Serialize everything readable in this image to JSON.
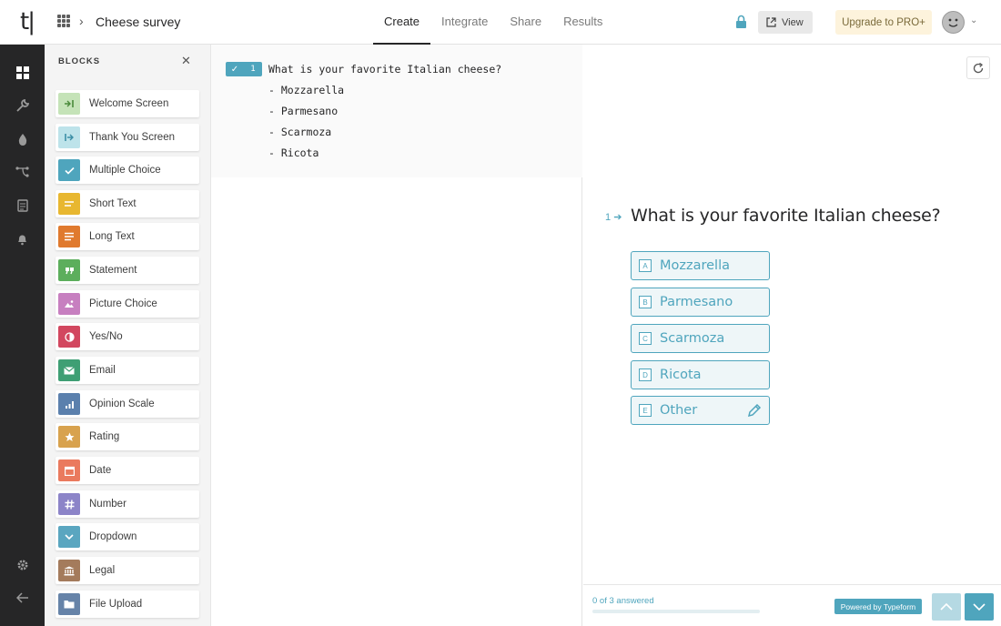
{
  "header": {
    "logo": "t|",
    "form_title": "Cheese survey",
    "tabs": [
      {
        "label": "Create",
        "active": true
      },
      {
        "label": "Integrate",
        "active": false
      },
      {
        "label": "Share",
        "active": false
      },
      {
        "label": "Results",
        "active": false
      }
    ],
    "view_label": "View",
    "upgrade_label": "Upgrade to PRO+"
  },
  "rail": {
    "icons": [
      "blocks-icon",
      "wrench-icon",
      "drop-icon",
      "logic-icon",
      "clipboard-icon",
      "bell-icon",
      "settings-icon",
      "back-arrow-icon"
    ]
  },
  "blocks_panel": {
    "title": "BLOCKS",
    "items": [
      {
        "label": "Welcome Screen",
        "color": "#c5e3b8",
        "icon": "welcome-icon"
      },
      {
        "label": "Thank You Screen",
        "color": "#bde3ea",
        "icon": "thank-you-icon"
      },
      {
        "label": "Multiple Choice",
        "color": "#4fa5bd",
        "icon": "check-icon"
      },
      {
        "label": "Short Text",
        "color": "#e8b730",
        "icon": "short-text-icon"
      },
      {
        "label": "Long Text",
        "color": "#e07a2e",
        "icon": "long-text-icon"
      },
      {
        "label": "Statement",
        "color": "#5cae5c",
        "icon": "quote-icon"
      },
      {
        "label": "Picture Choice",
        "color": "#c77fc0",
        "icon": "picture-icon"
      },
      {
        "label": "Yes/No",
        "color": "#d2475f",
        "icon": "yes-no-icon"
      },
      {
        "label": "Email",
        "color": "#3f9f74",
        "icon": "email-icon"
      },
      {
        "label": "Opinion Scale",
        "color": "#5b80ad",
        "icon": "opinion-scale-icon"
      },
      {
        "label": "Rating",
        "color": "#d8a24e",
        "icon": "star-icon"
      },
      {
        "label": "Date",
        "color": "#ea7a5e",
        "icon": "calendar-icon"
      },
      {
        "label": "Number",
        "color": "#8c84c8",
        "icon": "hash-icon"
      },
      {
        "label": "Dropdown",
        "color": "#5aa6c0",
        "icon": "chevron-down-icon"
      },
      {
        "label": "Legal",
        "color": "#a47b5c",
        "icon": "legal-icon"
      },
      {
        "label": "File Upload",
        "color": "#6683a8",
        "icon": "folder-icon"
      }
    ]
  },
  "editor": {
    "question_number": "1",
    "lines": [
      "What is your favorite Italian cheese?",
      "- Mozzarella",
      "- Parmesano",
      "- Scarmoza",
      "- Ricota"
    ]
  },
  "preview": {
    "question_number": "1",
    "question_text": "What is your favorite Italian cheese?",
    "choices": [
      {
        "key": "A",
        "label": "Mozzarella"
      },
      {
        "key": "B",
        "label": "Parmesano"
      },
      {
        "key": "C",
        "label": "Scarmoza"
      },
      {
        "key": "D",
        "label": "Ricota"
      },
      {
        "key": "E",
        "label": "Other"
      }
    ],
    "answered_text": "0 of 3 answered",
    "progress": 0,
    "powered_by": "Powered by Typeform",
    "accent": "#4fa5bd"
  }
}
